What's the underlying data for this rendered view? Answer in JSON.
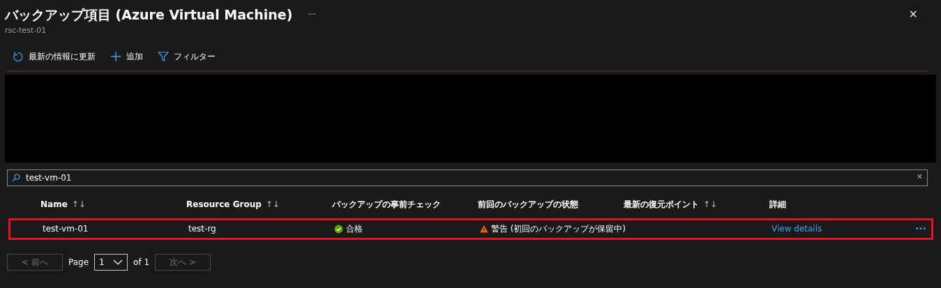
{
  "header": {
    "title": "バックアップ項目 (Azure Virtual Machine)",
    "more": "···",
    "close": "✕",
    "subtitle": "rsc-test-01"
  },
  "toolbar": [
    {
      "kind": "refresh",
      "label": "最新の情報に更新"
    },
    {
      "kind": "add",
      "label": "追加"
    },
    {
      "kind": "filter",
      "label": "フィルター"
    }
  ],
  "redacted": true,
  "search": {
    "value": "test-vm-01",
    "clear": "✕"
  },
  "table": {
    "columns": [
      {
        "label": "Name",
        "sort_icon": "↑↓"
      },
      {
        "label": "Resource Group",
        "sort_icon": "↑↓"
      },
      {
        "label": "バックアップの事前チェック"
      },
      {
        "label": "前回のバックアップの状態"
      },
      {
        "label": "最新の復元ポイント",
        "sort_icon": "↑↓"
      },
      {
        "label": "詳細"
      }
    ],
    "rows": [
      {
        "highlighted": true,
        "name": "test-vm-01",
        "resource_group": "test-rg",
        "precheck": {
          "kind": "passed",
          "text": "合格"
        },
        "last_backup": {
          "kind": "warning",
          "text": "警告 (初回のバックアップが保留中)"
        },
        "details_link": "View details",
        "more": "···"
      }
    ]
  },
  "pagination": {
    "prev": "< 前へ",
    "page_label": "Page",
    "page": "1",
    "of": "of 1",
    "next": "次へ >",
    "prev_disabled": true,
    "next_disabled": true
  }
}
